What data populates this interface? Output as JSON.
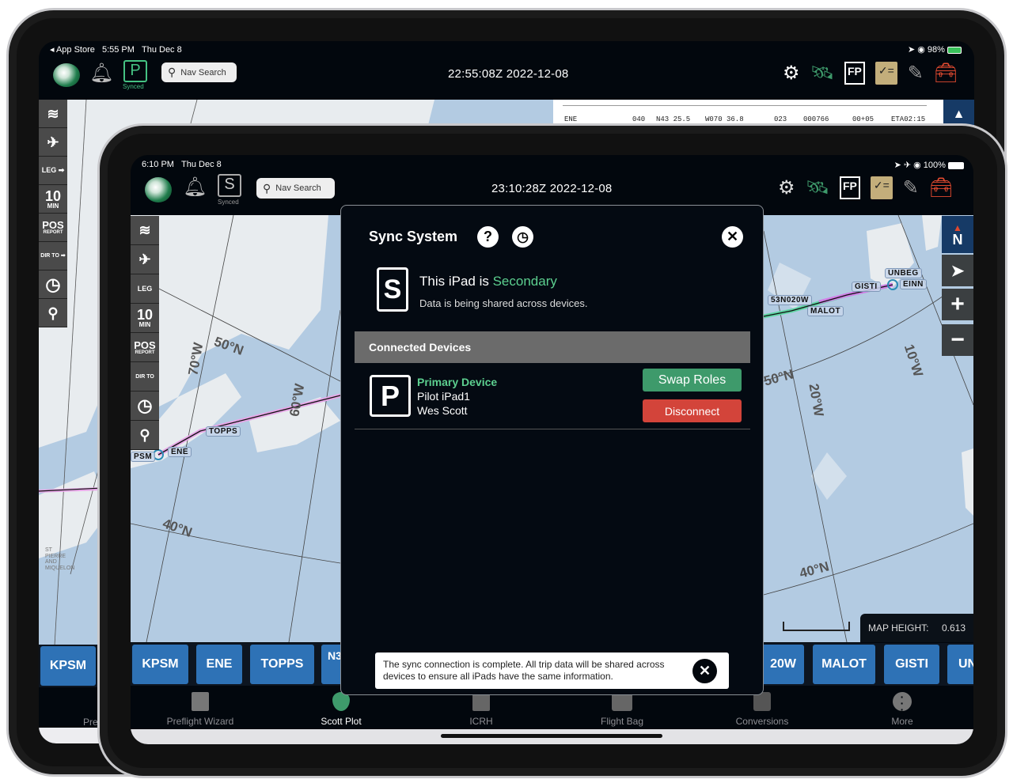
{
  "back_ipad": {
    "status": {
      "back_app": "◂ App Store",
      "time": "5:55 PM",
      "date": "Thu Dec 8",
      "battery": "98%"
    },
    "header": {
      "sync_letter": "P",
      "sync_status": "Synced",
      "nav_search": "Nav Search",
      "utc": "22:55:08Z  2022-12-08"
    },
    "sidebar": [
      "layers",
      "traffic",
      "LEG",
      "10",
      "MIN",
      "POS",
      "REPORT",
      "DIR TO",
      "clock",
      "pin"
    ],
    "flight_log_row": [
      "ENE",
      "040",
      "N43 25.5",
      "W070 36.8",
      "023",
      "000766",
      "00+05",
      "ETA02:15"
    ],
    "waypoint": "KPSM",
    "tab_partial": "Pre"
  },
  "front_ipad": {
    "status": {
      "time": "6:10 PM",
      "date": "Thu Dec 8",
      "battery": "100%"
    },
    "header": {
      "sync_letter": "S",
      "sync_status": "Synced",
      "nav_search": "Nav Search",
      "utc": "23:10:28Z  2022-12-08"
    },
    "sidebar": {
      "leg": "LEG",
      "ten": "10",
      "min": "MIN",
      "pos": "POS",
      "report": "REPORT",
      "dirto": "DIR TO"
    },
    "map": {
      "waypoints": [
        "PSM",
        "ENE",
        "TOPPS",
        "53N020W",
        "MALOT",
        "GISTI",
        "UNBEG",
        "EINN"
      ],
      "grid": [
        "50°N",
        "70°W",
        "60°W",
        "50°N",
        "20°W",
        "10°W",
        "40°N",
        "40°N"
      ],
      "compass": "N",
      "map_height_label": "MAP HEIGHT:",
      "map_height_value": "0.613"
    },
    "waypoint_bar": [
      "KPSM",
      "ENE",
      "TOPPS",
      "N3",
      "20W",
      "MALOT",
      "GISTI",
      "UN"
    ],
    "tabs": [
      {
        "label": "Preflight Wizard",
        "icon": "wizard-icon"
      },
      {
        "label": "Scott Plot",
        "icon": "scott-plot-icon",
        "active": true
      },
      {
        "label": "ICRH",
        "icon": "icrh-icon"
      },
      {
        "label": "Flight Bag",
        "icon": "flight-bag-icon"
      },
      {
        "label": "Conversions",
        "icon": "conversions-icon"
      },
      {
        "label": "More",
        "icon": "more-icon"
      }
    ]
  },
  "modal": {
    "title": "Sync System",
    "role_letter": "S",
    "role_prefix": "This iPad is ",
    "role": "Secondary",
    "role_desc": "Data is being shared across devices.",
    "section": "Connected Devices",
    "device": {
      "letter": "P",
      "role": "Primary Device",
      "name": "Pilot iPad1",
      "user": "Wes Scott"
    },
    "swap_label": "Swap Roles",
    "disconnect_label": "Disconnect",
    "toast": "The sync connection is complete. All trip data will be shared across devices to ensure all iPads have the same information."
  },
  "colors": {
    "accent_green": "#5ccf8f",
    "swap": "#3e9a6b",
    "disconnect": "#d3443a",
    "waypoint_blue": "#2e72b6",
    "map_water": "#b3cbe2",
    "land": "#e8ecef"
  }
}
